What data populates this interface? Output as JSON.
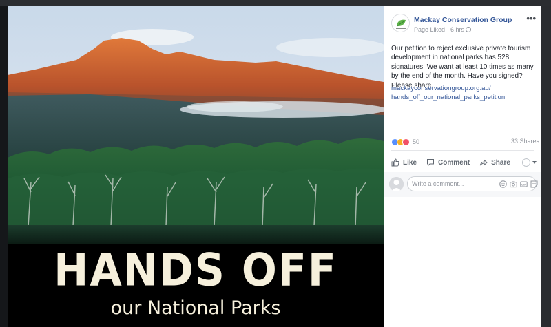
{
  "image": {
    "headline": "HANDS OFF",
    "subline": "our National Parks"
  },
  "post": {
    "page_name": "Mackay Conservation Group",
    "status": "Page Liked",
    "separator": " · ",
    "time": "6 hrs",
    "more": "•••",
    "body": "Our petition to reject exclusive private tourism development in national parks has 528 signatures. We want at least 10 times as many by the end of the month. Have you signed? Please share.",
    "link_line1": "mackayconservationgroup.org.au/",
    "link_line2": "hands_off_our_national_parks_petition",
    "reactions_count": "50",
    "shares": "33 Shares",
    "actions": {
      "like": "Like",
      "comment": "Comment",
      "share": "Share"
    },
    "comment_placeholder": "Write a comment...",
    "reaction_icons": [
      "like-reaction-icon",
      "haha-reaction-icon",
      "love-reaction-icon"
    ],
    "comment_tool_icons": [
      "emoji-icon",
      "camera-icon",
      "gif-icon",
      "sticker-icon"
    ]
  },
  "colors": {
    "link": "#365899",
    "text": "#1d2129",
    "muted": "#90949c",
    "like": "#5890ff",
    "haha": "#f7b125",
    "love": "#f25268",
    "headline": "#f6f0dc"
  }
}
